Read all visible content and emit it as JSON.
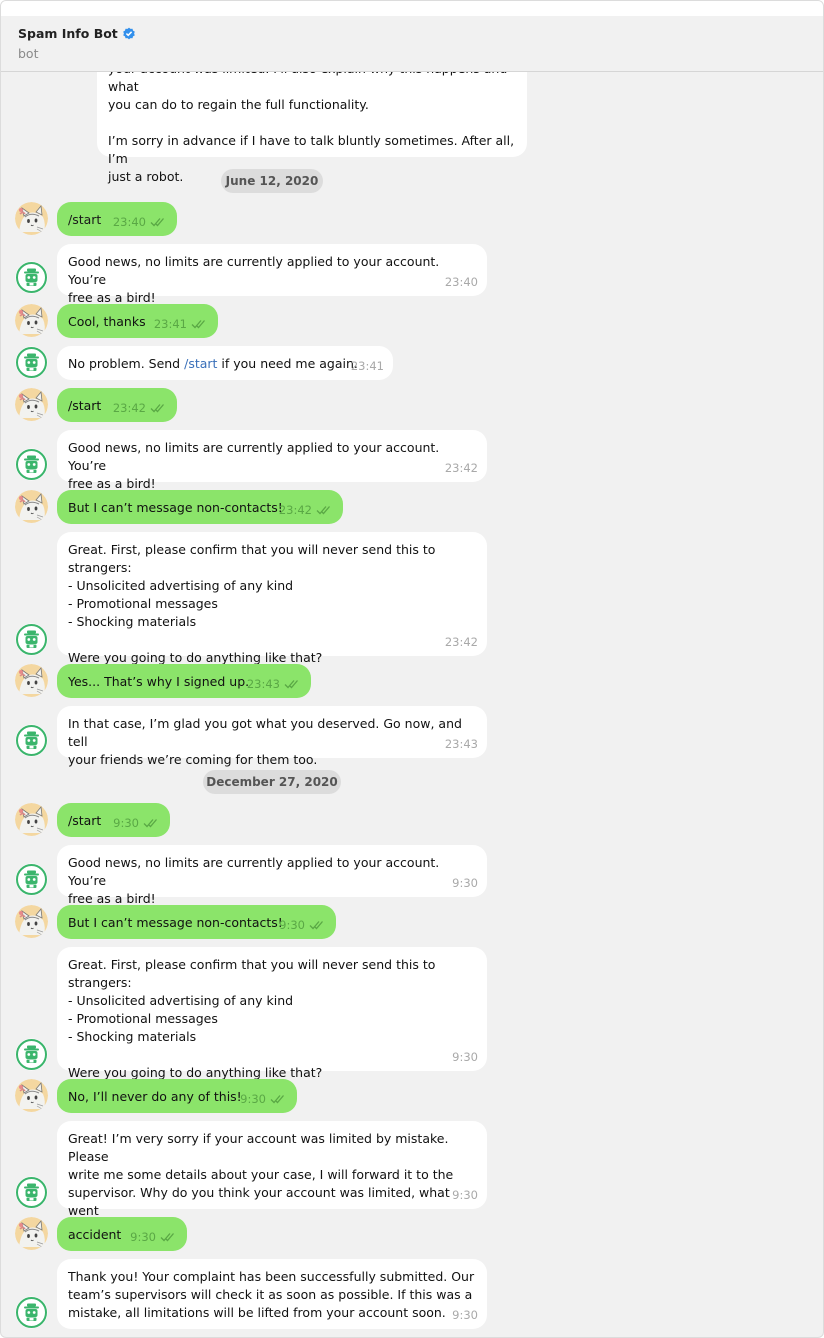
{
  "header": {
    "title": "Spam Info Bot",
    "subtitle": "bot"
  },
  "dates": [
    "June 12, 2020",
    "December 27, 2020"
  ],
  "top_message": {
    "line0": "your account was limited. I'll also explain why this happens and what",
    "line1": "you can do to regain the full functionality.",
    "line2": "I’m sorry in advance if I have to talk bluntly sometimes. After all, I’m",
    "line3": "just a robot."
  },
  "messages": [
    {
      "text": "/start",
      "time": "23:40"
    },
    {
      "text": "Good news, no limits are currently applied to your account. You’re\nfree as a bird!",
      "time": "23:40"
    },
    {
      "text": "Cool, thanks",
      "time": "23:41"
    },
    {
      "text_pre": "No problem. Send ",
      "cmd": "/start",
      "text_post": " if you need me again.",
      "time": "23:41"
    },
    {
      "text": "/start",
      "time": "23:42"
    },
    {
      "text": "Good news, no limits are currently applied to your account. You’re\nfree as a bird!",
      "time": "23:42"
    },
    {
      "text": "But I can’t message non-contacts!",
      "time": "23:42"
    },
    {
      "text": "Great. First, please confirm that you will never send this to strangers:\n- Unsolicited advertising of any kind\n- Promotional messages\n- Shocking materials\n\nWere you going to do anything like that?",
      "time": "23:42"
    },
    {
      "text": "Yes... That’s why I signed up.",
      "time": "23:43"
    },
    {
      "text": "In that case, I’m glad you got what you deserved. Go now, and tell\nyour friends we’re coming for them too.",
      "time": "23:43"
    },
    {
      "text": "/start",
      "time": "9:30"
    },
    {
      "text": "Good news, no limits are currently applied to your account. You’re\nfree as a bird!",
      "time": "9:30"
    },
    {
      "text": "But I can’t message non-contacts!",
      "time": "9:30"
    },
    {
      "text": "Great. First, please confirm that you will never send this to strangers:\n- Unsolicited advertising of any kind\n- Promotional messages\n- Shocking materials\n\nWere you going to do anything like that?",
      "time": "9:30"
    },
    {
      "text": "No, I’ll never do any of this!",
      "time": "9:30"
    },
    {
      "text": "Great! I’m very sorry if your account was limited by mistake. Please\nwrite me some details about your case, I will forward it to the\nsupervisor. Why do you think your account was limited, what went\nwrong?",
      "time": "9:30"
    },
    {
      "text": "accident",
      "time": "9:30"
    },
    {
      "text": "Thank you! Your complaint has been successfully submitted. Our\nteam’s supervisors will check it as soon as possible. If this was a\nmistake, all limitations will be lifted from your account soon.",
      "time": "9:30"
    }
  ],
  "colors": {
    "outgoing": "#8be46a",
    "incoming": "#ffffff",
    "background": "#f1f1f1",
    "verified": "#3390ec",
    "bot_icon": "#3bb56c"
  },
  "icons": {
    "verified": "verified-badge-icon",
    "read": "double-check-icon",
    "bot_avatar": "robot-icon",
    "user_avatar": "cat-avatar"
  }
}
